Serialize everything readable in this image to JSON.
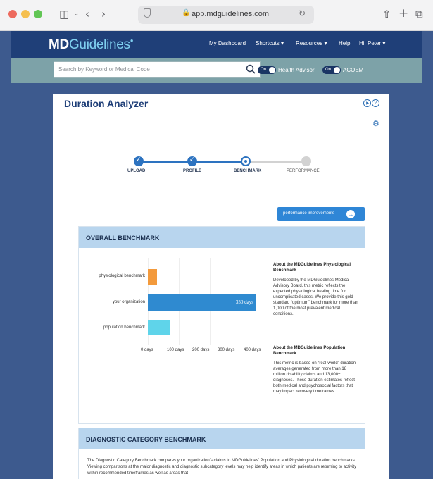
{
  "browser": {
    "url": "app.mdguidelines.com"
  },
  "nav": {
    "logo_md": "MD",
    "logo_guidelines": "Guidelines",
    "logo_mark": "●",
    "items": [
      "My Dashboard",
      "Shortcuts ▾",
      "Resources ▾",
      "Help",
      "Hi, Peter ▾"
    ]
  },
  "search": {
    "placeholder": "Search by Keyword or Medical Code",
    "toggles": [
      {
        "state": "On",
        "label": "Health Advisor"
      },
      {
        "state": "On",
        "label": "ACOEM"
      }
    ]
  },
  "page": {
    "title": "Duration Analyzer",
    "help_label": "?"
  },
  "stepper": {
    "steps": [
      {
        "label": "UPLOAD",
        "status": "done"
      },
      {
        "label": "PROFILE",
        "status": "done"
      },
      {
        "label": "BENCHMARK",
        "status": "active"
      },
      {
        "label": "PERFORMANCE",
        "status": "todo"
      }
    ]
  },
  "performance_button": {
    "label": "performance improvements",
    "icon": "→"
  },
  "overall": {
    "title": "OVERALL BENCHMARK",
    "about": [
      {
        "title": "About the MDGuidelines Physiological Benchmark",
        "text": "Developed by the MDGuidelines Medical Advisory Board, this metric reflects the expected physiological healing time for uncomplicated cases. We provide this gold-standard “optimum” benchmark for more than 1,000 of the most prevalent medical conditions."
      },
      {
        "title": "About the MDGuidelines Population Benchmark",
        "text": "This metric is based on “real-world” duration averages generated from more than 18 million disability claims and 13,000+ diagnoses. These duration estimates reflect both medical and psychosocial factors that may impact recovery timeframes."
      }
    ]
  },
  "chart_data": {
    "type": "bar",
    "orientation": "horizontal",
    "categories": [
      "physiological benchmark",
      "your organization",
      "population benchmark"
    ],
    "values": [
      30,
      350,
      70
    ],
    "value_labels": [
      "",
      "350 days",
      ""
    ],
    "colors": [
      "#f39a3c",
      "#2f8ad0",
      "#5fd4ea"
    ],
    "xticks": [
      "0 days",
      "100 days",
      "200 days",
      "300 days",
      "400 days"
    ],
    "xlim": [
      0,
      400
    ],
    "grid": true
  },
  "diagnostic": {
    "title": "DIAGNOSTIC CATEGORY BENCHMARK",
    "text": "The Diagnostic Category Benchmark compares your organization’s claims to MDGuidelines’ Population and Physiological duration benchmarks. Viewing comparisons at the major diagnostic and diagnostic subcategory levels may help identify areas in which patients are returning to activity within recommended timeframes as well as areas that"
  },
  "colors": {
    "nav": "#1f3f78",
    "accent": "#2f86d6",
    "title_underline": "#f0b24a",
    "panel_header": "#b8d5ee"
  }
}
